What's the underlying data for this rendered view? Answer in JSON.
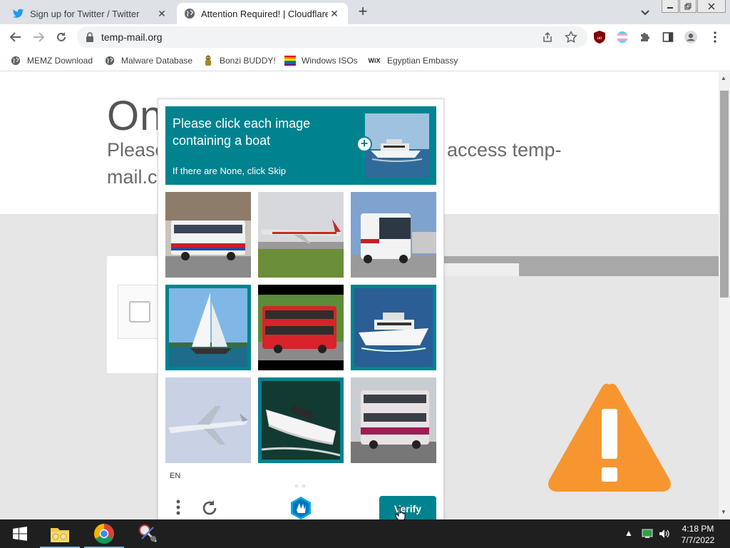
{
  "browser": {
    "tabs": [
      {
        "title": "Sign up for Twitter / Twitter",
        "favicon": "twitter-bird-icon",
        "active": false
      },
      {
        "title": "Attention Required! | Cloudflare",
        "favicon": "globe-icon",
        "active": true
      }
    ],
    "new_tab_symbol": "+",
    "url": "temp-mail.org"
  },
  "bookmarks": [
    {
      "label": "MEMZ Download",
      "icon": "globe-icon"
    },
    {
      "label": "Malware Database",
      "icon": "globe-icon"
    },
    {
      "label": "Bonzi BUDDY!",
      "icon": "bonzi-icon"
    },
    {
      "label": "Windows ISOs",
      "icon": "rainbow-flag-icon"
    },
    {
      "label": "Egyptian Embassy",
      "icon": "wix-icon"
    }
  ],
  "page": {
    "heading_partial": "On",
    "line1_left": "Please",
    "line1_right": "access temp-",
    "line2_left": "mail.c"
  },
  "captcha": {
    "prompt_title": "Please click each image containing a boat",
    "prompt_sub": "If there are None, click Skip",
    "language": "EN",
    "verify_label": "Verify",
    "images": [
      {
        "subject": "bus",
        "selected": false
      },
      {
        "subject": "airplane",
        "selected": false
      },
      {
        "subject": "bus",
        "selected": false
      },
      {
        "subject": "sailboat",
        "selected": true
      },
      {
        "subject": "bus",
        "selected": false
      },
      {
        "subject": "yacht",
        "selected": true
      },
      {
        "subject": "airplane",
        "selected": false
      },
      {
        "subject": "speedboat",
        "selected": true
      },
      {
        "subject": "bus",
        "selected": false
      }
    ]
  },
  "taskbar": {
    "time": "4:18 PM",
    "date": "7/7/2022"
  },
  "colors": {
    "captcha_teal": "#00838f",
    "warning_orange": "#f79631",
    "taskbar_bg": "#1f1f1f"
  }
}
